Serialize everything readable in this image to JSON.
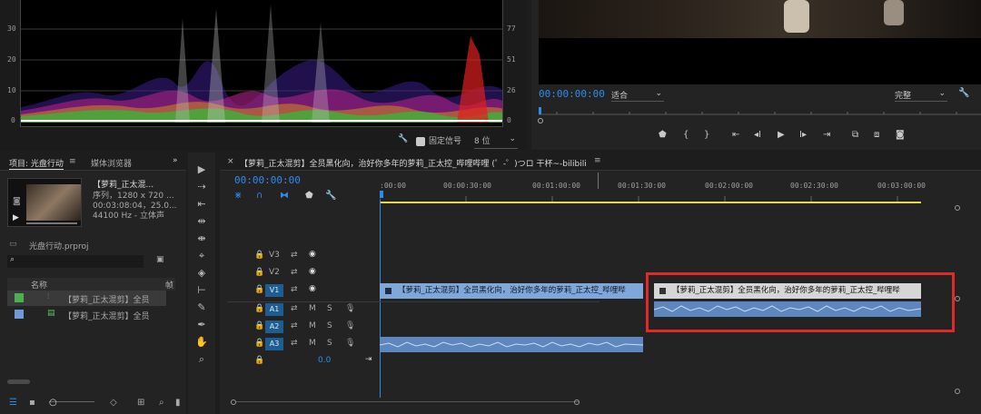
{
  "scopes": {
    "y_labels_left": [
      "30",
      "20",
      "10",
      "0"
    ],
    "y_labels_right": [
      "77",
      "51",
      "26",
      "0"
    ],
    "fixed_signal_label": "固定信号",
    "fixed_signal_checked": true,
    "bit_depth": "8 位"
  },
  "program_monitor": {
    "timecode": "00:00:00:00",
    "zoom": "适合",
    "quality": "完整"
  },
  "project_panel": {
    "tab_project": "项目: 光盘行动",
    "tab_media_browser": "媒体浏览器",
    "clip_title": "【萝莉_正太混...",
    "clip_info_1": "序列，1280 x 720 ...",
    "clip_info_2": "00:03:08:04，25.0...",
    "clip_info_3": "44100 Hz - 立体声",
    "project_file": "光盘行动.prproj",
    "search_value": "",
    "column_name": "名称",
    "column_rate": "帧",
    "items": [
      {
        "label": "【萝莉_正太混剪】全员",
        "color": "#4caf50"
      },
      {
        "label": "【萝莉_正太混剪】全员",
        "color": "#6e9bd8"
      }
    ]
  },
  "timeline": {
    "tab_title": "【萝莉_正太混剪】全员黑化向，治好你多年的萝莉_正太控_哔哩哔哩 (゜-゜)つロ 干杯~-bilibili",
    "timecode": "00:00:00:00",
    "ruler": [
      ":00:00",
      "00:00:30:00",
      "00:01:00:00",
      "00:01:30:00",
      "00:02:00:00",
      "00:02:30:00",
      "00:03:00:00"
    ],
    "tracks": {
      "v3": "V3",
      "v2": "V2",
      "v1": "V1",
      "a1": "A1",
      "a2": "A2",
      "a3": "A3",
      "mute": "M",
      "solo": "S",
      "volume": "0.0"
    },
    "clips": {
      "v1_clip1": "【萝莉_正太混剪】全员黑化向，治好你多年的萝莉_正太控_哔哩哔",
      "v1_clip2": "【萝莉_正太混剪】全员黑化向，治好你多年的萝莉_正太控_哔哩哔"
    },
    "highlight_color": "#e02a2a"
  }
}
